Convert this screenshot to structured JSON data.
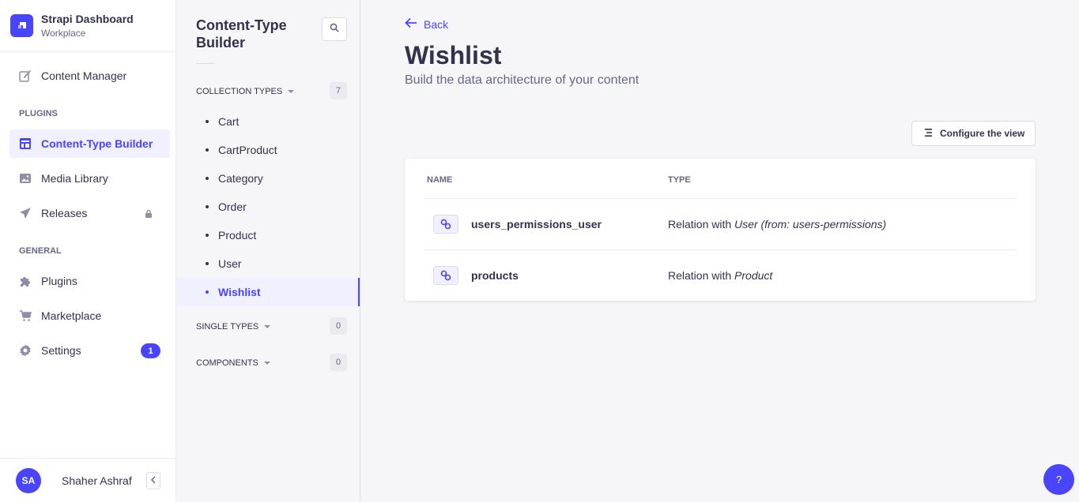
{
  "brand": {
    "title": "Strapi Dashboard",
    "workspace": "Workplace"
  },
  "mainnav": {
    "content_manager": "Content Manager",
    "plugins_section": "PLUGINS",
    "content_type_builder": "Content-Type Builder",
    "media_library": "Media Library",
    "releases": "Releases",
    "general_section": "GENERAL",
    "plugins": "Plugins",
    "marketplace": "Marketplace",
    "settings": "Settings",
    "settings_badge": "1"
  },
  "user": {
    "initials": "SA",
    "name": "Shaher Ashraf"
  },
  "subnav": {
    "title": "Content-Type Builder",
    "collection_types": {
      "label": "COLLECTION TYPES",
      "count": "7",
      "items": [
        "Cart",
        "CartProduct",
        "Category",
        "Order",
        "Product",
        "User",
        "Wishlist"
      ]
    },
    "single_types": {
      "label": "SINGLE TYPES",
      "count": "0"
    },
    "components": {
      "label": "COMPONENTS",
      "count": "0"
    }
  },
  "main": {
    "back_label": "Back",
    "title": "Wishlist",
    "subtitle": "Build the data architecture of your content",
    "configure_label": "Configure the view",
    "table": {
      "col_name": "NAME",
      "col_type": "TYPE",
      "rows": [
        {
          "name": "users_permissions_user",
          "type_prefix": "Relation with ",
          "type_target": "User (from: users-permissions)"
        },
        {
          "name": "products",
          "type_prefix": "Relation with ",
          "type_target": "Product"
        }
      ]
    }
  },
  "help_label": "?",
  "colors": {
    "primary": "#4945ff",
    "primary_light": "#f0f0ff",
    "text": "#32324d",
    "muted": "#666687"
  }
}
